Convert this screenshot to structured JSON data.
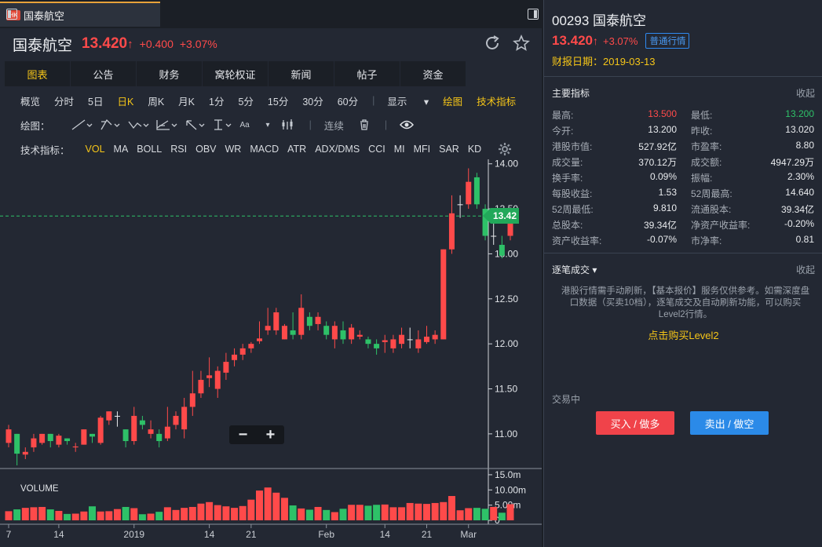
{
  "tab": {
    "badge": "HK",
    "title": "国泰航空"
  },
  "header": {
    "name": "国泰航空",
    "price": "13.420",
    "arrow": "↑",
    "change": "+0.400",
    "change_pct": "+3.07%"
  },
  "nav_tabs": [
    "图表",
    "公告",
    "财务",
    "窝轮权证",
    "新闻",
    "帖子",
    "资金"
  ],
  "nav_active": 0,
  "periods": [
    "概览",
    "分时",
    "5日",
    "日K",
    "周K",
    "月K",
    "1分",
    "5分",
    "15分",
    "30分",
    "60分"
  ],
  "period_active": 3,
  "toolbar_right": {
    "display": "显示",
    "draw": "绘图",
    "indicators": "技术指标"
  },
  "draw_toolbar": {
    "label": "绘图：",
    "continuous": "连续",
    "text_tool": "Aa"
  },
  "indicator_bar": {
    "label": "技术指标：",
    "items": [
      "VOL",
      "MA",
      "BOLL",
      "RSI",
      "OBV",
      "WR",
      "MACD",
      "ATR",
      "ADX/DMS",
      "CCI",
      "MI",
      "MFI",
      "SAR",
      "KD"
    ],
    "active": 0
  },
  "price_tag": "13.42",
  "zoom": {
    "minus": "−",
    "plus": "+"
  },
  "chart_data": {
    "type": "candlestick",
    "ylim": [
      10.65,
      14.05
    ],
    "y_ticks": [
      "14.00",
      "13.50",
      "13.00",
      "12.50",
      "12.00",
      "11.50",
      "11.00"
    ],
    "y_tick_values": [
      14.0,
      13.5,
      13.0,
      12.5,
      12.0,
      11.5,
      11.0
    ],
    "last_price": 13.42,
    "x_labels": [
      "7",
      "14",
      "2019",
      "14",
      "21",
      "Feb",
      "14",
      "21",
      "Mar"
    ],
    "x_label_index": [
      0,
      6,
      15,
      24,
      29,
      38,
      45,
      50,
      55
    ],
    "volume_label": "VOLUME",
    "volume_ticks": [
      "15.0m",
      "10.00m",
      "5.00m",
      "0"
    ],
    "volume_tick_values": [
      15,
      10,
      5,
      0
    ],
    "volume_ylim": [
      0,
      15.5
    ],
    "candles": [
      {
        "o": 10.9,
        "c": 11.05,
        "h": 11.1,
        "l": 10.85
      },
      {
        "o": 11.0,
        "c": 10.78,
        "h": 11.0,
        "l": 10.65
      },
      {
        "o": 10.77,
        "c": 10.8,
        "h": 10.85,
        "l": 10.72
      },
      {
        "o": 10.85,
        "c": 10.95,
        "h": 11.0,
        "l": 10.8
      },
      {
        "o": 10.9,
        "c": 11.0,
        "h": 11.0,
        "l": 10.88
      },
      {
        "o": 11.0,
        "c": 10.92,
        "h": 11.0,
        "l": 10.85
      },
      {
        "o": 10.88,
        "c": 10.98,
        "h": 11.0,
        "l": 10.85
      },
      {
        "o": 10.95,
        "c": 10.92,
        "h": 10.95,
        "l": 10.88
      },
      {
        "o": 10.85,
        "c": 10.86,
        "h": 10.9,
        "l": 10.8
      },
      {
        "o": 10.88,
        "c": 11.05,
        "h": 11.05,
        "l": 10.88
      },
      {
        "o": 11.0,
        "c": 10.97,
        "h": 11.0,
        "l": 10.9
      },
      {
        "o": 10.9,
        "c": 11.18,
        "h": 11.2,
        "l": 10.88
      },
      {
        "o": 11.15,
        "c": 11.25,
        "h": 11.25,
        "l": 11.1
      },
      {
        "o": 11.2,
        "c": 11.2,
        "h": 11.25,
        "l": 11.08
      },
      {
        "o": 11.05,
        "c": 10.92,
        "h": 11.05,
        "l": 10.85
      },
      {
        "o": 10.92,
        "c": 11.2,
        "h": 11.3,
        "l": 10.88
      },
      {
        "o": 11.15,
        "c": 11.1,
        "h": 11.2,
        "l": 11.05
      },
      {
        "o": 11.0,
        "c": 11.05,
        "h": 11.15,
        "l": 10.95
      },
      {
        "o": 11.0,
        "c": 10.92,
        "h": 11.05,
        "l": 10.85
      },
      {
        "o": 10.95,
        "c": 11.08,
        "h": 11.3,
        "l": 10.92
      },
      {
        "o": 11.1,
        "c": 11.2,
        "h": 11.25,
        "l": 11.05
      },
      {
        "o": 11.05,
        "c": 11.3,
        "h": 11.4,
        "l": 10.95
      },
      {
        "o": 11.3,
        "c": 11.45,
        "h": 11.7,
        "l": 11.2
      },
      {
        "o": 11.45,
        "c": 11.6,
        "h": 11.7,
        "l": 11.4
      },
      {
        "o": 11.62,
        "c": 11.65,
        "h": 11.85,
        "l": 11.52
      },
      {
        "o": 11.5,
        "c": 11.7,
        "h": 11.75,
        "l": 11.4
      },
      {
        "o": 11.68,
        "c": 11.8,
        "h": 11.9,
        "l": 11.6
      },
      {
        "o": 11.82,
        "c": 11.88,
        "h": 11.95,
        "l": 11.75
      },
      {
        "o": 11.88,
        "c": 11.95,
        "h": 12.0,
        "l": 11.82
      },
      {
        "o": 11.95,
        "c": 12.0,
        "h": 12.02,
        "l": 11.9
      },
      {
        "o": 12.03,
        "c": 12.06,
        "h": 12.25,
        "l": 12.0
      },
      {
        "o": 12.15,
        "c": 12.2,
        "h": 12.4,
        "l": 12.1
      },
      {
        "o": 12.15,
        "c": 12.35,
        "h": 12.4,
        "l": 12.1
      },
      {
        "o": 12.05,
        "c": 12.2,
        "h": 12.22,
        "l": 12.05
      },
      {
        "o": 12.15,
        "c": 12.1,
        "h": 12.35,
        "l": 12.05
      },
      {
        "o": 12.1,
        "c": 12.4,
        "h": 12.55,
        "l": 12.05
      },
      {
        "o": 12.3,
        "c": 12.2,
        "h": 12.35,
        "l": 12.15
      },
      {
        "o": 12.22,
        "c": 12.3,
        "h": 12.35,
        "l": 12.15
      },
      {
        "o": 12.2,
        "c": 12.1,
        "h": 12.25,
        "l": 12.05
      },
      {
        "o": 12.05,
        "c": 12.2,
        "h": 12.25,
        "l": 11.95
      },
      {
        "o": 12.15,
        "c": 12.05,
        "h": 12.25,
        "l": 12.0
      },
      {
        "o": 12.05,
        "c": 12.18,
        "h": 12.22,
        "l": 12.0
      },
      {
        "o": 12.08,
        "c": 12.1,
        "h": 12.15,
        "l": 12.05
      },
      {
        "o": 12.05,
        "c": 12.0,
        "h": 12.08,
        "l": 11.95
      },
      {
        "o": 12.0,
        "c": 11.95,
        "h": 12.05,
        "l": 11.88
      },
      {
        "o": 12.02,
        "c": 12.04,
        "h": 12.1,
        "l": 11.9
      },
      {
        "o": 11.95,
        "c": 12.05,
        "h": 12.1,
        "l": 11.9
      },
      {
        "o": 12.0,
        "c": 12.1,
        "h": 12.18,
        "l": 11.95
      },
      {
        "o": 12.05,
        "c": 12.05,
        "h": 12.18,
        "l": 11.95
      },
      {
        "o": 11.95,
        "c": 12.05,
        "h": 12.15,
        "l": 11.9
      },
      {
        "o": 12.02,
        "c": 12.08,
        "h": 12.2,
        "l": 12.0
      },
      {
        "o": 12.05,
        "c": 12.1,
        "h": 12.15,
        "l": 12.0
      },
      {
        "o": 12.05,
        "c": 13.05,
        "h": 13.05,
        "l": 12.05
      },
      {
        "o": 13.05,
        "c": 13.45,
        "h": 13.65,
        "l": 13.0
      },
      {
        "o": 13.55,
        "c": 13.55,
        "h": 13.65,
        "l": 13.4
      },
      {
        "o": 13.55,
        "c": 13.8,
        "h": 13.95,
        "l": 13.5
      },
      {
        "o": 13.85,
        "c": 13.55,
        "h": 13.9,
        "l": 13.5
      },
      {
        "o": 13.5,
        "c": 13.2,
        "h": 13.55,
        "l": 13.15
      },
      {
        "o": 13.2,
        "c": 13.2,
        "h": 13.35,
        "l": 13.1
      },
      {
        "o": 13.1,
        "c": 12.98,
        "h": 13.2,
        "l": 12.95
      },
      {
        "o": 13.2,
        "c": 13.42,
        "h": 13.5,
        "l": 13.15
      }
    ],
    "volumes": [
      3.0,
      3.6,
      4.1,
      4.3,
      4.4,
      3.6,
      3.1,
      2.1,
      2.2,
      2.9,
      4.6,
      2.9,
      3.0,
      3.7,
      4.4,
      4.0,
      2.0,
      2.2,
      2.8,
      4.3,
      3.4,
      4.1,
      4.4,
      5.5,
      6.0,
      5.0,
      4.6,
      4.1,
      4.7,
      6.8,
      9.8,
      10.8,
      9.1,
      7.4,
      4.9,
      3.9,
      3.5,
      4.4,
      3.4,
      2.7,
      3.8,
      5.1,
      5.1,
      4.8,
      5.1,
      5.2,
      4.3,
      4.3,
      5.7,
      5.5,
      5.4,
      5.7,
      6.0,
      8.0,
      3.3,
      4.0,
      4.1,
      3.8,
      4.4,
      2.5,
      5.3
    ]
  },
  "right": {
    "title": "00293 国泰航空",
    "price": "13.420",
    "arrow": "↑",
    "change_pct": "+3.07%",
    "quote_type": "普通行情",
    "report_label": "财报日期：",
    "report_date": "2019-03-13",
    "metrics_title": "主要指标",
    "collapse": "收起",
    "metrics": [
      [
        {
          "k": "最高:",
          "v": "13.500",
          "c": "red"
        },
        {
          "k": "最低:",
          "v": "13.200",
          "c": "green"
        }
      ],
      [
        {
          "k": "今开:",
          "v": "13.200",
          "c": ""
        },
        {
          "k": "昨收:",
          "v": "13.020",
          "c": ""
        }
      ],
      [
        {
          "k": "港股市值:",
          "v": "527.92亿",
          "c": ""
        },
        {
          "k": "市盈率:",
          "v": "8.80",
          "c": ""
        }
      ],
      [
        {
          "k": "成交量:",
          "v": "370.12万",
          "c": ""
        },
        {
          "k": "成交额:",
          "v": "4947.29万",
          "c": ""
        }
      ],
      [
        {
          "k": "换手率:",
          "v": "0.09%",
          "c": ""
        },
        {
          "k": "振幅:",
          "v": "2.30%",
          "c": ""
        }
      ],
      [
        {
          "k": "每股收益:",
          "v": "1.53",
          "c": ""
        },
        {
          "k": "52周最高:",
          "v": "14.640",
          "c": ""
        }
      ],
      [
        {
          "k": "52周最低:",
          "v": "9.810",
          "c": ""
        },
        {
          "k": "流通股本:",
          "v": "39.34亿",
          "c": ""
        }
      ],
      [
        {
          "k": "总股本:",
          "v": "39.34亿",
          "c": ""
        },
        {
          "k": "净资产收益率:",
          "v": "-0.20%",
          "c": ""
        }
      ],
      [
        {
          "k": "资产收益率:",
          "v": "-0.07%",
          "c": ""
        },
        {
          "k": "市净率:",
          "v": "0.81",
          "c": ""
        }
      ]
    ],
    "ticks_title": "逐笔成交",
    "ticks_collapse": "收起",
    "notice": "港股行情需手动刷新，【基本报价】服务仅供参考。如需深度盘口数据（买卖10档），逐笔成交及自动刷新功能，可以购买Level2行情。",
    "buy_level2": "点击购买Level2",
    "trading_status": "交易中",
    "buy_button": "买入 / 做多",
    "sell_button": "卖出 / 做空"
  },
  "colors": {
    "up": "#ff4a4a",
    "down": "#2ec168",
    "accent": "#f5c518",
    "buy": "#f0434a",
    "sell": "#2b8ae8"
  }
}
